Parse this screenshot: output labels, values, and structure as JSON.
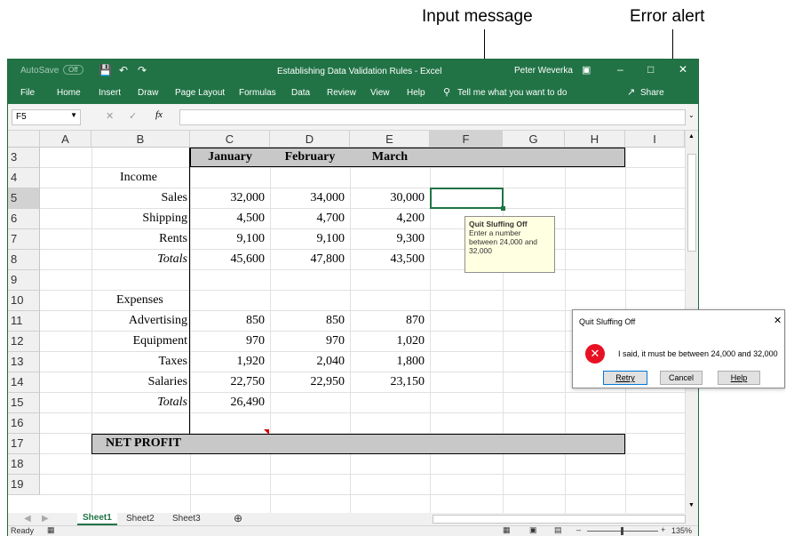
{
  "callouts": {
    "input_message": "Input message",
    "error_alert": "Error alert"
  },
  "titlebar": {
    "autosave": "AutoSave",
    "autosave_state": "Off",
    "title": "Establishing Data Validation Rules - Excel",
    "user": "Peter Weverka"
  },
  "menu": {
    "items": [
      "File",
      "Home",
      "Insert",
      "Draw",
      "Page Layout",
      "Formulas",
      "Data",
      "Review",
      "View",
      "Help"
    ],
    "tell_me": "Tell me what you want to do",
    "share": "Share"
  },
  "formula_bar": {
    "name_box": "F5",
    "fx": "fx",
    "value": ""
  },
  "columns": [
    "A",
    "B",
    "C",
    "D",
    "E",
    "F",
    "G",
    "H",
    "I"
  ],
  "rows": [
    "3",
    "4",
    "5",
    "6",
    "7",
    "8",
    "9",
    "10",
    "11",
    "12",
    "13",
    "14",
    "15",
    "16",
    "17",
    "18",
    "19"
  ],
  "sheet": {
    "headers": [
      "January",
      "February",
      "March"
    ],
    "income_label": "Income",
    "income": [
      {
        "label": "Sales",
        "values": [
          "32,000",
          "34,000",
          "30,000"
        ]
      },
      {
        "label": "Shipping",
        "values": [
          "4,500",
          "4,700",
          "4,200"
        ]
      },
      {
        "label": "Rents",
        "values": [
          "9,100",
          "9,100",
          "9,300"
        ]
      },
      {
        "label": "Totals",
        "values": [
          "45,600",
          "47,800",
          "43,500"
        ]
      }
    ],
    "expenses_label": "Expenses",
    "expenses": [
      {
        "label": "Advertising",
        "values": [
          "850",
          "850",
          "870"
        ]
      },
      {
        "label": "Equipment",
        "values": [
          "970",
          "970",
          "1,020"
        ]
      },
      {
        "label": "Taxes",
        "values": [
          "1,920",
          "2,040",
          "1,800"
        ]
      },
      {
        "label": "Salaries",
        "values": [
          "22,750",
          "22,950",
          "23,150"
        ]
      },
      {
        "label": "Totals",
        "values": [
          "26,490",
          "",
          ""
        ]
      }
    ],
    "net_profit": "NET PROFIT"
  },
  "input_tip": {
    "title": "Quit Sluffing Off",
    "body": "Enter a number between 24,000 and 32,000"
  },
  "error_dialog": {
    "title": "Quit Sluffing Off",
    "message": "I said, it must be between 24,000 and 32,000",
    "retry": "Retry",
    "cancel": "Cancel",
    "help": "Help"
  },
  "tabs": [
    "Sheet1",
    "Sheet2",
    "Sheet3"
  ],
  "status": {
    "ready": "Ready",
    "zoom": "135%"
  },
  "colors": {
    "excel_green": "#217346",
    "error_red": "#e81123",
    "tip_bg": "#ffffe1"
  }
}
